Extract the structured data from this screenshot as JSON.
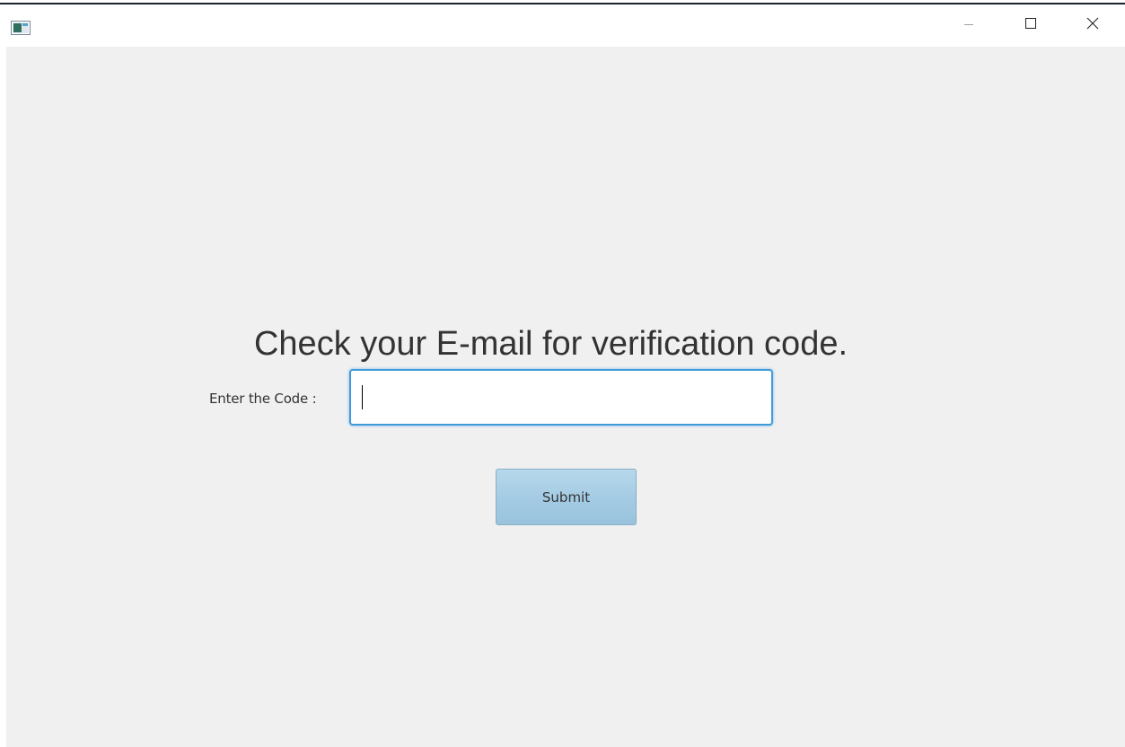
{
  "window": {
    "controls": {
      "minimize_icon": "minimize-icon",
      "maximize_icon": "maximize-icon",
      "close_icon": "close-icon"
    }
  },
  "form": {
    "heading": "Check your E-mail for verification code.",
    "code_label": "Enter the Code :",
    "code_value": "",
    "submit_label": "Submit"
  },
  "colors": {
    "client_background": "#f0f0f0",
    "input_focus_border": "#3f9bd9",
    "button_fill": "#a3cbe3",
    "text": "#333333"
  }
}
